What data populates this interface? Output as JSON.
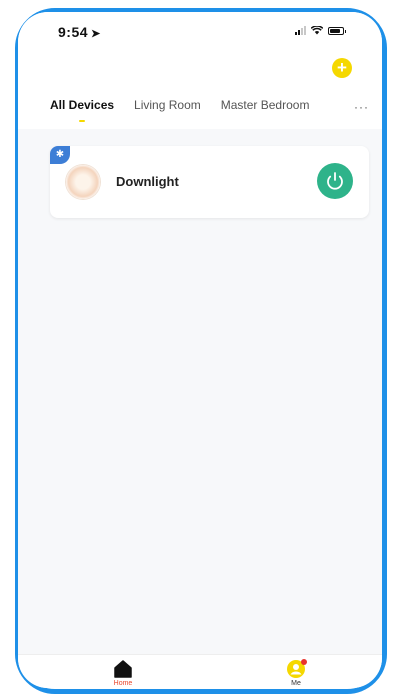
{
  "status_bar": {
    "time": "9:54",
    "location_arrow": "➤"
  },
  "header": {
    "add_icon": "plus-icon",
    "add_symbol": "+"
  },
  "tabs": [
    {
      "label": "All Devices",
      "active": true
    },
    {
      "label": "Living Room",
      "active": false
    },
    {
      "label": "Master Bedroom",
      "active": false
    }
  ],
  "tabs_more": "···",
  "devices": [
    {
      "name": "Downlight",
      "badge_icon": "bluetooth-icon",
      "badge_symbol": "✱",
      "power_icon": "power-icon"
    }
  ],
  "tab_bar": {
    "home_label": "Home",
    "me_label": "Me"
  },
  "colors": {
    "frame": "#1e90e8",
    "accent_yellow": "#f5d800",
    "power_green": "#2eb38a",
    "bluetooth_blue": "#3d7ed6",
    "home_active": "#e8472c"
  }
}
